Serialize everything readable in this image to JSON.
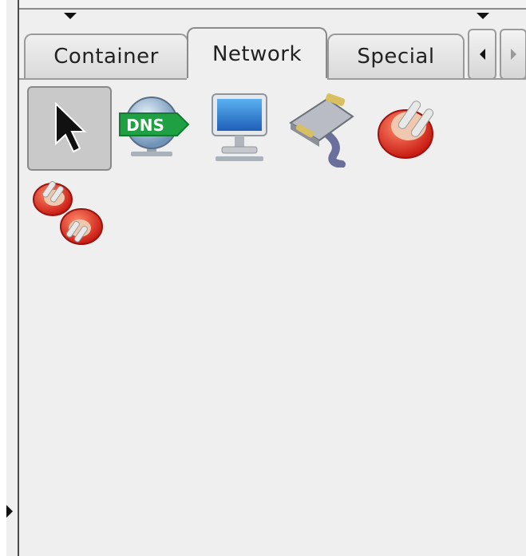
{
  "tabs": [
    {
      "label": "Container",
      "active": false
    },
    {
      "label": "Network",
      "active": true
    },
    {
      "label": "Special",
      "active": false
    }
  ],
  "dns_label": "DNS",
  "tools": [
    {
      "name": "pointer",
      "icon": "arrow-pointer-icon",
      "selected": true
    },
    {
      "name": "dns-server",
      "icon": "dns-globe-icon",
      "selected": false
    },
    {
      "name": "computer",
      "icon": "monitor-icon",
      "selected": false
    },
    {
      "name": "serial-cable",
      "icon": "serial-cable-icon",
      "selected": false
    },
    {
      "name": "plug",
      "icon": "red-plug-icon",
      "selected": false
    },
    {
      "name": "connection",
      "icon": "plug-pair-icon",
      "selected": false
    }
  ],
  "colors": {
    "dns_badge": "#1ea043",
    "screen": "#2a7ad8",
    "plug_red": "#e0261c"
  }
}
